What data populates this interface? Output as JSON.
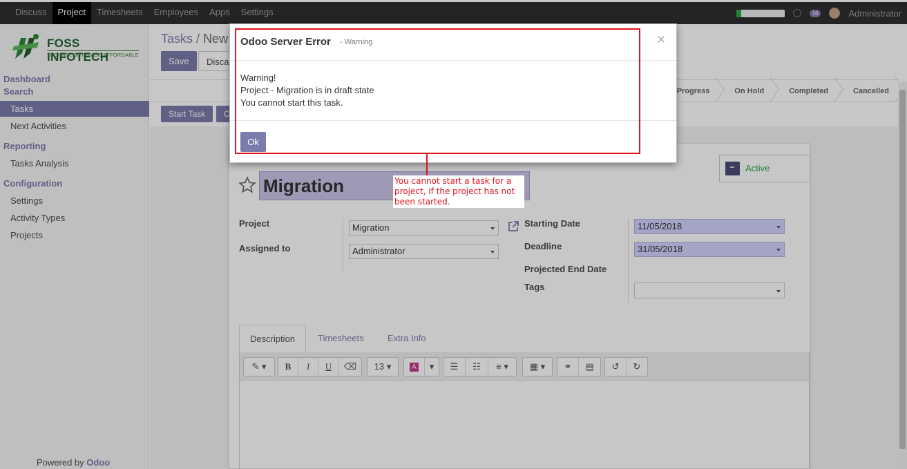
{
  "topbar": {
    "menu": [
      "Discuss",
      "Project",
      "Timesheets",
      "Employees",
      "Apps",
      "Settings"
    ],
    "active_menu": "Project",
    "chat_count": "16",
    "user_name": "Administrator",
    "progress_fraction": 0.1
  },
  "sidebar": {
    "logo_brand": "FOSS INFOTECH",
    "logo_tagline": "TECHNOLOGY MADE AFFORDABLE",
    "heading_dashboard": "Dashboard",
    "heading_search": "Search",
    "item_tasks": "Tasks",
    "item_next_activities": "Next Activities",
    "heading_reporting": "Reporting",
    "item_tasks_analysis": "Tasks Analysis",
    "heading_configuration": "Configuration",
    "item_settings": "Settings",
    "item_activity_types": "Activity Types",
    "item_projects": "Projects",
    "powered_by": "Powered by",
    "powered_brand": "Odoo"
  },
  "main": {
    "breadcrumb_parent": "Tasks",
    "breadcrumb_sep": "/",
    "breadcrumb_current": "New",
    "save_label": "Save",
    "discard_label": "Discard",
    "start_task_label": "Start Task",
    "second_action_label": "C",
    "stages": [
      "In Progress",
      "On Hold",
      "Completed",
      "Cancelled"
    ],
    "active_label": "Active",
    "task_name": "Migration",
    "project_label": "Project",
    "project_value": "Migration",
    "assigned_label": "Assigned to",
    "assigned_value": "Administrator",
    "starting_date_label": "Starting Date",
    "starting_date_value": "11/05/2018",
    "deadline_label": "Deadline",
    "deadline_value": "31/05/2018",
    "projected_end_label": "Projected End Date",
    "tags_label": "Tags",
    "tabs": [
      "Description",
      "Timesheets",
      "Extra Info"
    ],
    "font_size": "13"
  },
  "modal": {
    "title": "Odoo Server Error",
    "subtitle": "- Warning",
    "line1": "Warning!",
    "line2": "Project - Migration is in draft state",
    "line3": "You cannot start this task.",
    "ok_label": "Ok",
    "close_glyph": "×"
  },
  "annotation": {
    "text": "You cannot start a task for a project, if the project has not been started."
  },
  "colors": {
    "brand": "#7c7bad",
    "annotation_red": "#e0121c",
    "success": "#28a745"
  }
}
